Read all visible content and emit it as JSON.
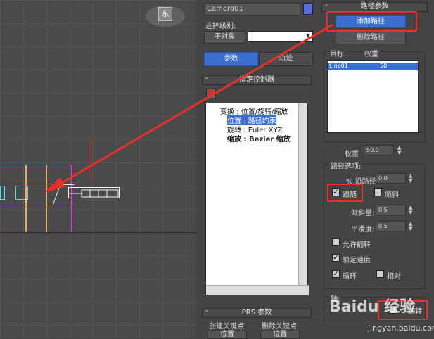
{
  "viewport": {
    "viewcube_label": "东"
  },
  "object_name": {
    "value": "Camera01"
  },
  "selection_level": {
    "label": "选择级别:",
    "button": "子对象",
    "dropdown_value": ""
  },
  "tabs": [
    {
      "label": "参数",
      "active": true
    },
    {
      "label": "轨迹",
      "active": false
    }
  ],
  "assign_controller": {
    "title": "指定控制器",
    "tree": [
      "变换 : 位置/旋转/缩放",
      "位置 : 路径约束",
      "旋转 : Euler XYZ",
      "缩放 : Bezier 缩放"
    ]
  },
  "prs_params": {
    "title": "PRS 参数",
    "create_key": "创建关键点",
    "delete_key": "删除关键点",
    "position_btn": "位置",
    "position_btn2": "位置"
  },
  "path_params": {
    "title": "路径参数",
    "add_path": "添加路径",
    "delete_path": "删除路径",
    "col_target": "目标",
    "col_weight": "权重",
    "rows": [
      {
        "target": "Line01",
        "weight": "50"
      }
    ],
    "weight_label": "权重",
    "weight_value": "50.0"
  },
  "path_options": {
    "title": "路径选项:",
    "along_path_label": "% 沿路径:",
    "along_path_value": "0.0",
    "follow": "跟随",
    "bank": "倾斜",
    "bank_amount_label": "倾斜量:",
    "bank_amount_value": "0.5",
    "smoothness_label": "平滑度:",
    "smoothness_value": "0.5",
    "allow_flip": "允许翻转",
    "constant_velocity": "恒定速度",
    "loop": "循环",
    "relative": "相对"
  },
  "axis": {
    "title": "轴:",
    "flip": "翻转"
  },
  "watermark": {
    "text": "Baidu 经验",
    "url": "jingyan.baidu.com"
  },
  "colors": {
    "accent_blue": "#3b6ecf",
    "annotation_red": "#e8302a"
  }
}
